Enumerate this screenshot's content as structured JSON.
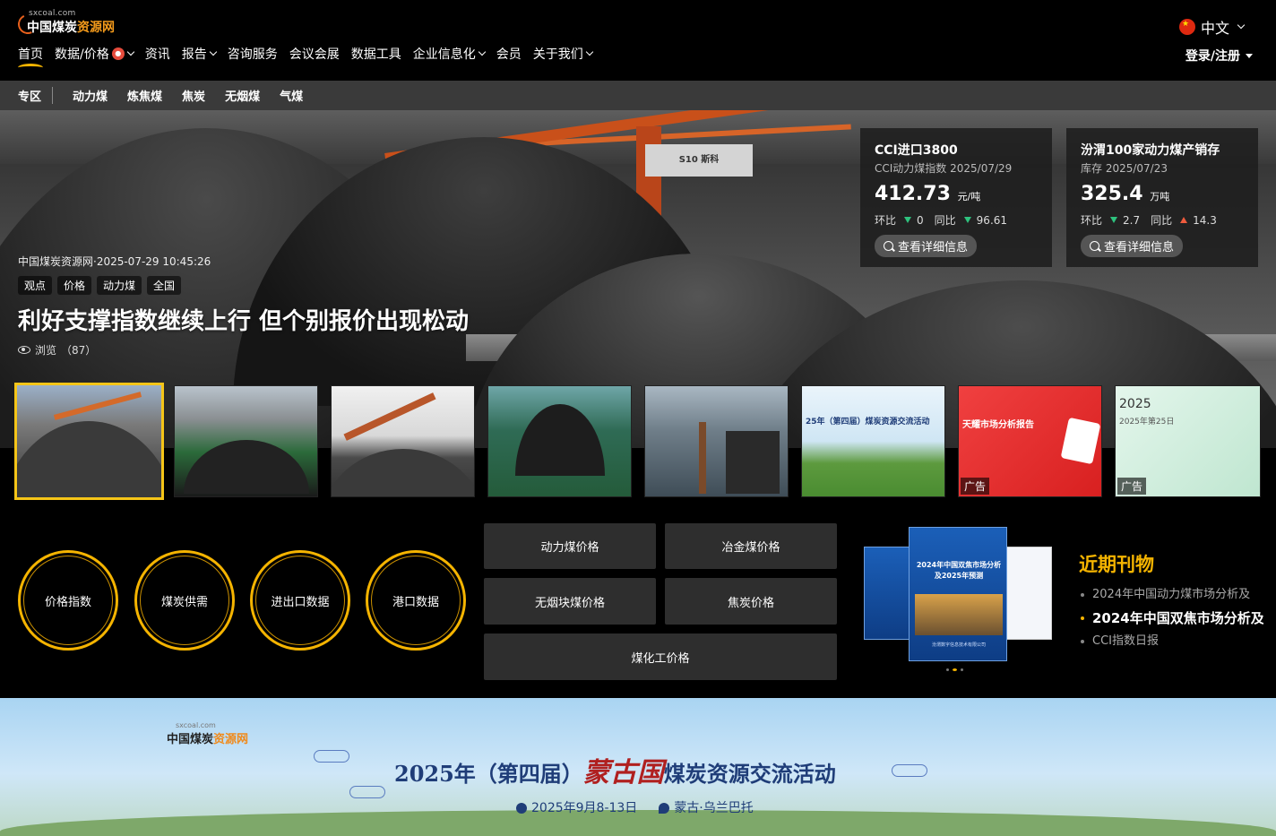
{
  "header": {
    "logo_small": "sxcoal.com",
    "logo_brand_1": "中国煤炭",
    "logo_brand_2": "资源网",
    "language": "中文",
    "login": "登录/注册",
    "nav": [
      {
        "label": "首页",
        "active": true,
        "dropdown": false
      },
      {
        "label": "数据/价格",
        "dropdown": true,
        "hot": true
      },
      {
        "label": "资讯",
        "dropdown": false
      },
      {
        "label": "报告",
        "dropdown": true
      },
      {
        "label": "咨询服务",
        "dropdown": false
      },
      {
        "label": "会议会展",
        "dropdown": false
      },
      {
        "label": "数据工具",
        "dropdown": false
      },
      {
        "label": "企业信息化",
        "dropdown": true
      },
      {
        "label": "会员",
        "dropdown": false
      },
      {
        "label": "关于我们",
        "dropdown": true
      }
    ]
  },
  "subnav": {
    "zone": "专区",
    "items": [
      "动力煤",
      "炼焦煤",
      "焦炭",
      "无烟煤",
      "气煤"
    ]
  },
  "hero": {
    "meta": "中国煤炭资源网·2025-07-29 10:45:26",
    "tags": [
      "观点",
      "价格",
      "动力煤",
      "全国"
    ],
    "title": "利好支撑指数继续上行 但个别报价出现松动",
    "views_label": "浏览",
    "views_count": "（87）",
    "crane_text": "S10 斯科"
  },
  "cards": [
    {
      "title": "CCI进口3800",
      "subtitle": "CCI动力煤指数 2025/07/29",
      "value": "412.73",
      "unit": "元/吨",
      "mom_label": "环比",
      "mom_value": "0",
      "mom_dir": "down",
      "yoy_label": "同比",
      "yoy_value": "96.61",
      "yoy_dir": "down",
      "button": "查看详细信息"
    },
    {
      "title": "汾渭100家动力煤产销存",
      "subtitle": "库存 2025/07/23",
      "value": "325.4",
      "unit": "万吨",
      "mom_label": "环比",
      "mom_value": "2.7",
      "mom_dir": "down",
      "yoy_label": "同比",
      "yoy_value": "14.3",
      "yoy_dir": "up",
      "button": "查看详细信息"
    }
  ],
  "thumbs": {
    "ad_label": "广告",
    "t6_text": "25年（第四届）煤炭资源交流活动",
    "t7_text": "天耀市场分析报告",
    "t8_year": "2025",
    "t8_text": "2025年第25日"
  },
  "shortcuts": {
    "rings": [
      "价格指数",
      "煤炭供需",
      "进出口数据",
      "港口数据"
    ],
    "price_buttons": [
      "动力煤价格",
      "冶金煤价格",
      "无烟块煤价格",
      "焦炭价格",
      "煤化工价格"
    ]
  },
  "publications": {
    "title": "近期刊物",
    "book_text": "2024年中国双焦市场分析及2025年预测",
    "book_publisher": "汾渭数字信息技术有限公司",
    "items": [
      {
        "label": "2024年中国动力煤市场分析及",
        "active": false
      },
      {
        "label": "2024年中国双焦市场分析及",
        "active": true
      },
      {
        "label": "CCI指数日报",
        "active": false
      }
    ]
  },
  "banner": {
    "logo_small": "sxcoal.com",
    "logo_a": "中国煤炭",
    "logo_c": "资源网",
    "title_pre": "2025年（第四届）",
    "title_red": "蒙古国",
    "title_post": "煤炭资源交流活动",
    "date": "2025年9月8-13日",
    "location": "蒙古·乌兰巴托"
  },
  "colors": {
    "accent": "#f5b400",
    "down": "#2ec27e",
    "up": "#ef5b3d",
    "brand_orange": "#f39a1b"
  }
}
